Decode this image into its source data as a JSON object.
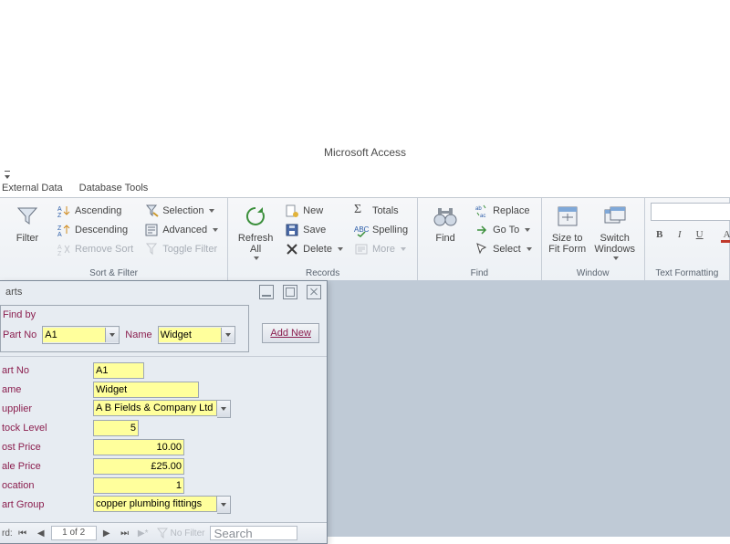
{
  "app_title": "Microsoft Access",
  "tabs": {
    "external_data": "External Data",
    "database_tools": "Database Tools"
  },
  "ribbon": {
    "sortfilter": {
      "label": "Sort & Filter",
      "filter": "Filter",
      "ascending": "Ascending",
      "descending": "Descending",
      "remove_sort": "Remove Sort",
      "selection": "Selection",
      "advanced": "Advanced",
      "toggle_filter": "Toggle Filter"
    },
    "records": {
      "label": "Records",
      "refresh": "Refresh\nAll",
      "new": "New",
      "save": "Save",
      "delete": "Delete",
      "totals": "Totals",
      "spelling": "Spelling",
      "more": "More"
    },
    "find": {
      "label": "Find",
      "find": "Find",
      "replace": "Replace",
      "goto": "Go To",
      "select": "Select"
    },
    "window": {
      "label": "Window",
      "sizefit": "Size to\nFit Form",
      "switch": "Switch\nWindows"
    },
    "textfmt": {
      "label": "Text Formatting",
      "bold": "B",
      "italic": "I",
      "underline": "U",
      "font_a": "A"
    }
  },
  "form": {
    "title": "arts",
    "findby": {
      "legend": "Find by",
      "partno_label": "Part No",
      "partno_value": "A1",
      "name_label": "Name",
      "name_value": "Widget",
      "addnew": "Add New"
    },
    "fields": {
      "partno": {
        "label": "art No",
        "value": "A1"
      },
      "name": {
        "label": "ame",
        "value": "Widget"
      },
      "supplier": {
        "label": "upplier",
        "value": "A B Fields & Company Ltd"
      },
      "stock": {
        "label": "tock Level",
        "value": "5"
      },
      "cost": {
        "label": "ost Price",
        "value": "10.00"
      },
      "sale": {
        "label": "ale Price",
        "value": "£25.00"
      },
      "location": {
        "label": "ocation",
        "value": "1"
      },
      "group": {
        "label": "art Group",
        "value": "copper plumbing fittings"
      }
    },
    "recnav": {
      "prefix": "rd:",
      "position": "1 of 2",
      "nofilter": "No Filter",
      "search": "Search"
    }
  }
}
